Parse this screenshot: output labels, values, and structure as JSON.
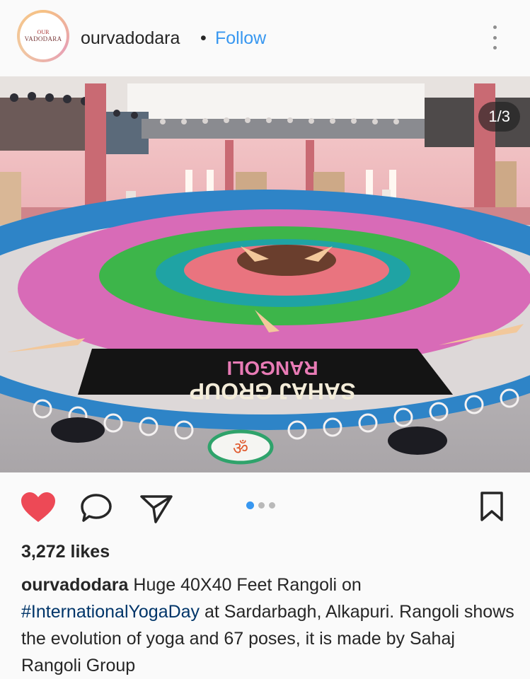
{
  "post": {
    "username": "ourvadodara",
    "separator": "•",
    "follow_label": "Follow",
    "avatar_text_line1": "OUR",
    "avatar_text_line2": "VADODARA",
    "more_icon": "more-vertical-icon",
    "image_counter": "1/3"
  },
  "actions": {
    "like_icon": "heart-icon",
    "comment_icon": "comment-icon",
    "share_icon": "send-icon",
    "save_icon": "bookmark-icon",
    "like_color": "#ed4956",
    "carousel_total": 3,
    "carousel_active": 1
  },
  "likes": {
    "text": "3,272 likes"
  },
  "caption": {
    "username": "ourvadodara",
    "text_part1": " Huge 40X40 Feet Rangoli on ",
    "hashtag": "#InternationalYogaDay",
    "text_part2": " at Sardarbagh, Alkapuri. Rangoli shows the evolution of yoga and 67 poses, it is made by Sahaj Rangoli Group"
  },
  "photo": {
    "rangoli_text_top": "RANGOLI",
    "rangoli_text_bottom": "SAHAJ GROUP",
    "om_symbol": "ॐ"
  }
}
